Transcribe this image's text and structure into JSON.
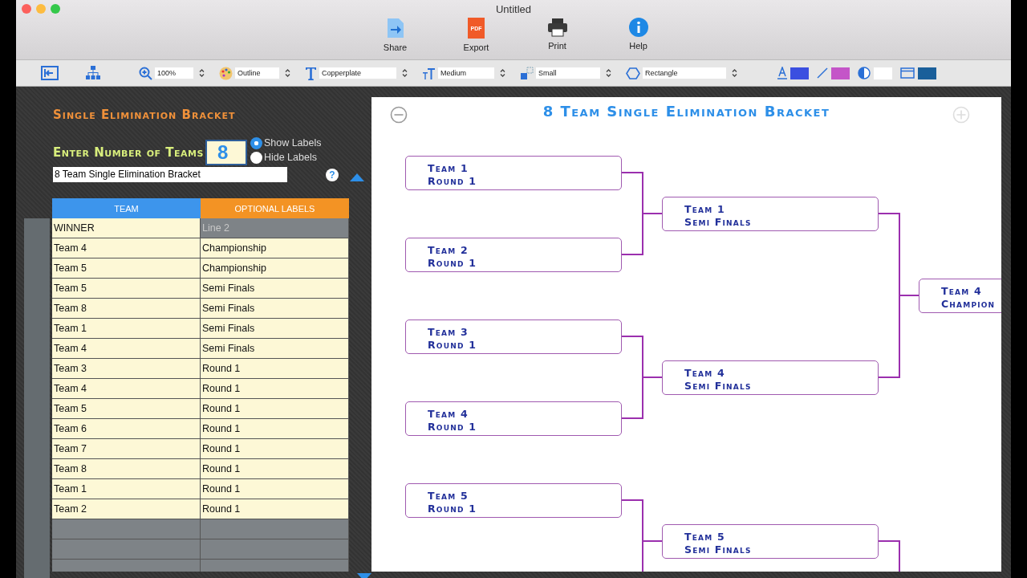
{
  "window": {
    "title": "Untitled"
  },
  "toolbar": {
    "buttons": [
      {
        "label": "Share",
        "kind": "share"
      },
      {
        "label": "Export",
        "kind": "export",
        "icon_text": "PDF"
      },
      {
        "label": "Print",
        "kind": "print"
      },
      {
        "label": "Help",
        "kind": "help"
      }
    ]
  },
  "format_bar": {
    "selects": [
      {
        "kind": "zoom",
        "value": "100%"
      },
      {
        "kind": "style",
        "value": "Outline"
      },
      {
        "kind": "font",
        "value": "Copperplate"
      },
      {
        "kind": "size",
        "value": "Medium"
      },
      {
        "kind": "spacing",
        "value": "Small"
      },
      {
        "kind": "shape",
        "value": "Rectangle"
      }
    ],
    "swatches": [
      {
        "kind": "text",
        "color": "#3b4fe0"
      },
      {
        "kind": "line",
        "color": "#c455c8"
      },
      {
        "kind": "fill",
        "color": "#ffffff"
      },
      {
        "kind": "background",
        "color": "#1a5f9a"
      }
    ]
  },
  "panel": {
    "heading": "Single Elimination Bracket",
    "teams_label": "Enter Number of Teams",
    "teams_value": "8",
    "label_options": [
      {
        "label": "Show Labels",
        "selected": true
      },
      {
        "label": "Hide Labels",
        "selected": false
      }
    ],
    "title_value": "8 Team Single Elimination Bracket",
    "help": "?",
    "table": {
      "columns": [
        "TEAM",
        "OPTIONAL LABELS"
      ],
      "rows": [
        {
          "team": "WINNER",
          "placeholder": "Line 2"
        },
        {
          "team": "Team 4",
          "label": "Championship"
        },
        {
          "team": "Team 5",
          "label": "Championship"
        },
        {
          "team": "Team 5",
          "label": "Semi Finals"
        },
        {
          "team": "Team 8",
          "label": "Semi Finals"
        },
        {
          "team": "Team 1",
          "label": "Semi Finals"
        },
        {
          "team": "Team 4",
          "label": "Semi Finals"
        },
        {
          "team": "Team 3",
          "label": "Round 1"
        },
        {
          "team": "Team 4",
          "label": "Round 1"
        },
        {
          "team": "Team 5",
          "label": "Round 1"
        },
        {
          "team": "Team 6",
          "label": "Round 1"
        },
        {
          "team": "Team 7",
          "label": "Round 1"
        },
        {
          "team": "Team 8",
          "label": "Round 1"
        },
        {
          "team": "Team 1",
          "label": "Round 1"
        },
        {
          "team": "Team 2",
          "label": "Round 1"
        }
      ]
    }
  },
  "bracket": {
    "title": "8 Team Single Elimination Bracket",
    "rounds": [
      {
        "slots": [
          {
            "team": "Team 1",
            "label": "Round 1"
          },
          {
            "team": "Team 2",
            "label": "Round 1"
          },
          {
            "team": "Team 3",
            "label": "Round 1"
          },
          {
            "team": "Team 4",
            "label": "Round 1"
          },
          {
            "team": "Team 5",
            "label": "Round 1"
          }
        ]
      },
      {
        "slots": [
          {
            "team": "Team 1",
            "label": "Semi Finals"
          },
          {
            "team": "Team 4",
            "label": "Semi Finals"
          },
          {
            "team": "Team 5",
            "label": "Semi Finals"
          }
        ]
      },
      {
        "slots": [
          {
            "team": "Team 4",
            "label": "Champion"
          }
        ]
      }
    ]
  }
}
